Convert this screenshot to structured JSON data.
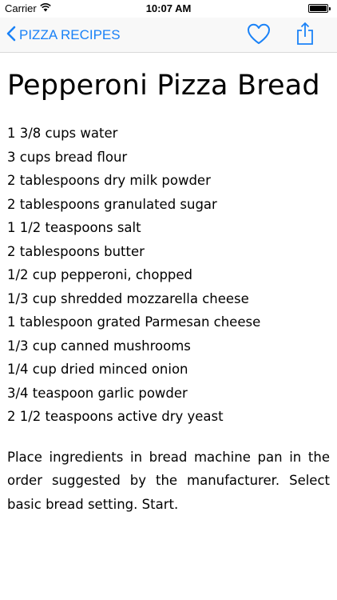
{
  "status_bar": {
    "carrier": "Carrier",
    "time": "10:07 AM",
    "battery_level": 1.0
  },
  "nav": {
    "back_label": "PIZZA RECIPES",
    "accent_color": "#1a82f7",
    "icons": [
      "chevron-left-icon",
      "heart-icon",
      "share-icon"
    ]
  },
  "recipe": {
    "title": "Pepperoni Pizza Bread",
    "ingredients": [
      "1 3/8 cups water",
      "3 cups bread flour",
      "2 tablespoons dry milk powder",
      "2 tablespoons granulated sugar",
      "1 1/2 teaspoons salt",
      "2 tablespoons butter",
      "1/2 cup pepperoni, chopped",
      "1/3 cup shredded mozzarella cheese",
      "1 tablespoon grated Parmesan cheese",
      "1/3 cup canned mushrooms",
      "1/4 cup dried minced onion",
      "3/4 teaspoon garlic powder",
      "2 1/2 teaspoons active dry yeast"
    ],
    "instructions": "Place ingredients in bread machine pan in the order suggested by the manufacturer. Select basic bread setting. Start."
  }
}
